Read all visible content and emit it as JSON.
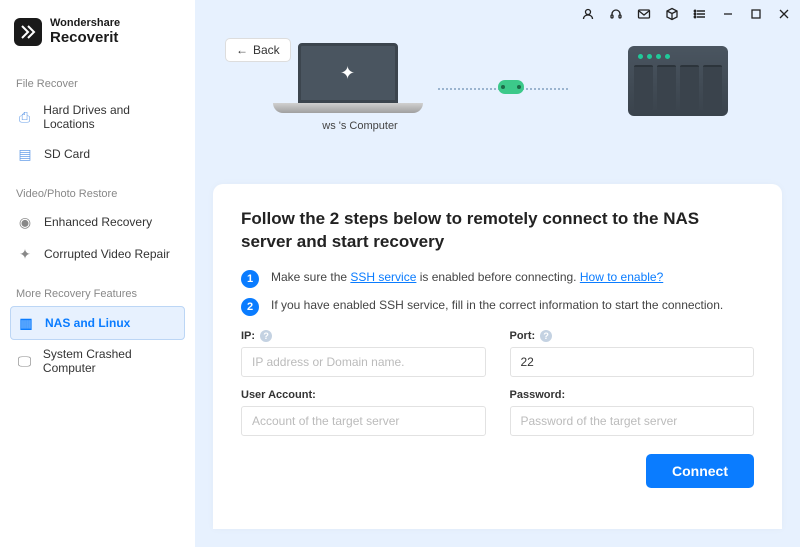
{
  "brand": {
    "top": "Wondershare",
    "bottom": "Recoverit"
  },
  "sections": {
    "file_recover": {
      "title": "File Recover",
      "items": [
        {
          "key": "hdd",
          "label": "Hard Drives and Locations",
          "icon": "disk-icon",
          "glyph": "⎙"
        },
        {
          "key": "sd",
          "label": "SD Card",
          "icon": "sd-icon",
          "glyph": "▤"
        }
      ]
    },
    "video_restore": {
      "title": "Video/Photo Restore",
      "items": [
        {
          "key": "enhanced",
          "label": "Enhanced Recovery",
          "icon": "camera-icon",
          "glyph": "◉"
        },
        {
          "key": "corrupted",
          "label": "Corrupted Video Repair",
          "icon": "wrench-icon",
          "glyph": "✦"
        }
      ]
    },
    "more_features": {
      "title": "More Recovery Features",
      "items": [
        {
          "key": "nas",
          "label": "NAS and Linux",
          "icon": "server-icon",
          "glyph": "▥",
          "active": true
        },
        {
          "key": "crashed",
          "label": "System Crashed Computer",
          "icon": "monitor-icon",
          "glyph": "🖵"
        }
      ]
    }
  },
  "titlebar": [
    "user-icon",
    "headset-icon",
    "mail-icon",
    "package-icon",
    "list-icon",
    "minimize-icon",
    "maximize-icon",
    "close-icon"
  ],
  "back_label": "Back",
  "illustration": {
    "computer_label": "ws 's Computer"
  },
  "panel": {
    "heading": "Follow the 2 steps below to remotely connect to the NAS server and start recovery",
    "step1_prefix": "Make sure the ",
    "step1_link": "SSH service",
    "step1_mid": " is enabled before connecting. ",
    "step1_howto": "How to enable?",
    "step2": "If you have enabled SSH service, fill in the correct information to start the connection.",
    "fields": {
      "ip": {
        "label": "IP:",
        "placeholder": "IP address or Domain name.",
        "value": ""
      },
      "port": {
        "label": "Port:",
        "placeholder": "",
        "value": "22"
      },
      "user": {
        "label": "User Account:",
        "placeholder": "Account of the target server",
        "value": ""
      },
      "password": {
        "label": "Password:",
        "placeholder": "Password of the target server",
        "value": ""
      }
    },
    "connect_label": "Connect"
  }
}
